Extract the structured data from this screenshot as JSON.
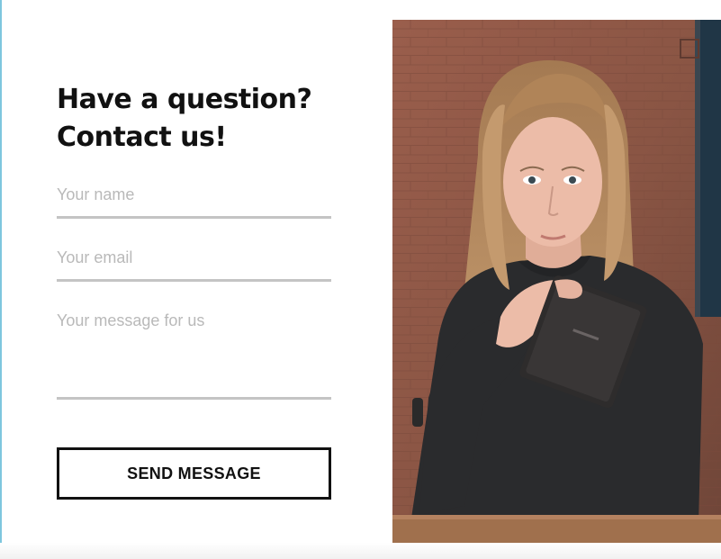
{
  "form": {
    "title_line1": "Have a question?",
    "title_line2": "Contact us!",
    "name_placeholder": "Your name",
    "email_placeholder": "Your email",
    "message_placeholder": "Your message for us",
    "send_label": "SEND MESSAGE"
  },
  "photo": {
    "subject": "woman-holding-notebook",
    "colors": {
      "brick": "#8a5544",
      "sweater": "#2a2b2d",
      "hair": "#b98a5e",
      "skin": "#e8b8a4",
      "table": "#a0704d"
    }
  },
  "colors": {
    "text": "#111111",
    "placeholder": "#b9b9b9",
    "underline": "#c4c4c4",
    "button_border": "#111111",
    "accent_edge": "#7ec6de"
  }
}
